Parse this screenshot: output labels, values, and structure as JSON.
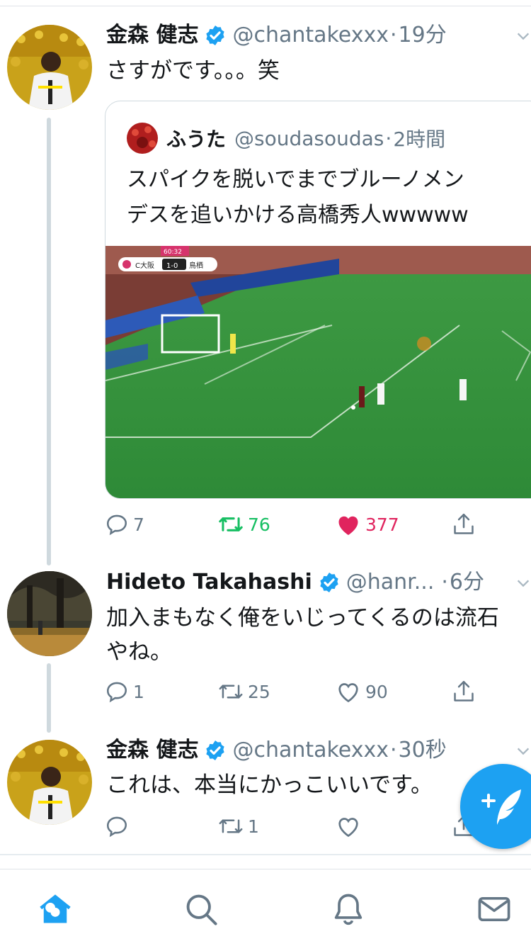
{
  "tweets": [
    {
      "name": "金森 健志",
      "handle": "@chantakexxx",
      "time": "19分",
      "text": "さすがです。。。笑",
      "verified": true,
      "quote": {
        "name": "ふうた",
        "handle": "@soudasoudas",
        "time": "2時間",
        "text_line1": "スパイクを脱いでまでブルーノメン",
        "text_line2": "デスを追いかける高橋秀人wwwww",
        "scoreboard": {
          "clock": "60:32",
          "home": "C大阪",
          "score": "1-0",
          "away": "鳥栖"
        }
      },
      "actions": {
        "replies": "7",
        "retweets": "76",
        "likes": "377",
        "retweeted": true,
        "liked": true
      }
    },
    {
      "name": "Hideto Takahashi",
      "handle": "@hanr...",
      "time": "6分",
      "text_line1": "加入まもなく俺をいじってくるのは流石",
      "text_line2": "やね。",
      "verified": true,
      "actions": {
        "replies": "1",
        "retweets": "25",
        "likes": "90"
      }
    },
    {
      "name": "金森 健志",
      "handle": "@chantakexxx",
      "time": "30秒",
      "text": "これは、本当にかっこいいです。",
      "verified": true,
      "actions": {
        "replies": "",
        "retweets": "1",
        "likes": ""
      }
    }
  ],
  "compose_button": {
    "icon": "compose-feather-icon",
    "color": "#1da1f2"
  },
  "tabbar": {
    "items": [
      {
        "icon": "home-icon",
        "active": true
      },
      {
        "icon": "search-icon",
        "active": false
      },
      {
        "icon": "bell-icon",
        "active": false
      },
      {
        "icon": "mail-icon",
        "active": false
      }
    ]
  },
  "colors": {
    "brand": "#1da1f2",
    "retweet": "#17bf63",
    "like": "#e0245e",
    "secondary_text": "#657786"
  }
}
